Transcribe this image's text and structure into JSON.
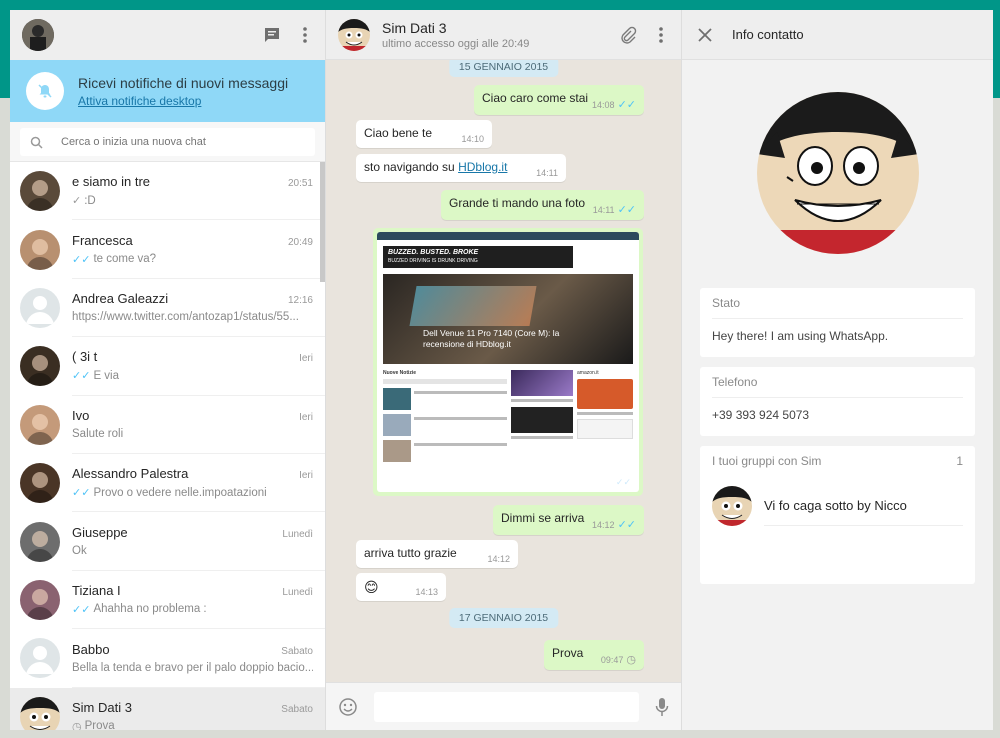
{
  "colors": {
    "teal": "#009688",
    "notif_bg": "#8fd8f7",
    "out_bubble": "#dcf8c6",
    "in_bubble": "#ffffff",
    "read_tick": "#4fc3f7"
  },
  "left": {
    "notification": {
      "title": "Ricevi notifiche di nuovi messaggi",
      "link": "Attiva notifiche desktop"
    },
    "search": {
      "placeholder": "Cerca o inizia una nuova chat"
    },
    "chats": [
      {
        "name": "e siamo in tre",
        "time": "20:51",
        "tick": "grey",
        "msg": ":D",
        "avatar": "#5a4a3a"
      },
      {
        "name": "Francesca",
        "time": "20:49",
        "tick": "blue",
        "msg": "te come va?",
        "avatar": "#b89070"
      },
      {
        "name": "Andrea Galeazzi",
        "time": "12:16",
        "tick": "",
        "msg": "https://www.twitter.com/antozap1/status/55...",
        "avatar": "placeholder"
      },
      {
        "name": "( 3i t",
        "time": "Ieri",
        "tick": "blue",
        "msg": "E via",
        "avatar": "#3a2e22"
      },
      {
        "name": "Ivo",
        "time": "Ieri",
        "tick": "",
        "msg": "Salute roli",
        "avatar": "#c49a7a"
      },
      {
        "name": "Alessandro Palestra",
        "time": "Ieri",
        "tick": "blue",
        "msg": "Provo o vedere nelle.impoatazioni",
        "avatar": "#4a3526"
      },
      {
        "name": "Giuseppe",
        "time": "Lunedì",
        "tick": "",
        "msg": "Ok",
        "avatar": "#6d6d6d"
      },
      {
        "name": "Tiziana I",
        "time": "Lunedì",
        "tick": "blue",
        "msg": "Ahahha no problema :",
        "avatar": "#8a6270"
      },
      {
        "name": "Babbo",
        "time": "Sabato",
        "tick": "",
        "msg": "Bella la tenda e bravo per il palo doppio bacio...",
        "avatar": "placeholder"
      },
      {
        "name": "Sim Dati 3",
        "time": "Sabato",
        "tick": "clock",
        "msg": "Prova",
        "avatar": "luffy"
      }
    ]
  },
  "chat": {
    "name": "Sim Dati 3",
    "status": "ultimo accesso oggi alle 20:49",
    "date1": "15 GENNAIO 2015",
    "date2": "17 GENNAIO 2015",
    "messages": [
      {
        "dir": "out",
        "text": "Ciao caro come stai",
        "time": "14:08"
      },
      {
        "dir": "in",
        "text": "Ciao bene te",
        "time": "14:10"
      },
      {
        "dir": "in",
        "text_pre": "sto navigando su ",
        "link": "HDblog.it",
        "time": "14:11"
      },
      {
        "dir": "out",
        "text": "Grande ti mando una foto",
        "time": "14:11"
      },
      {
        "dir": "out",
        "text": "Dimmi se arriva",
        "time": "14:12"
      },
      {
        "dir": "in",
        "text": "arriva tutto grazie",
        "time": "14:12"
      },
      {
        "dir": "in",
        "text": "😊",
        "time": "14:13"
      },
      {
        "dir": "out",
        "text": "Prova",
        "time": "09:47"
      }
    ],
    "photo": {
      "time": "14:12",
      "banner": "BUZZED. BUSTED. BROKE",
      "banner2": "BUZZED DRIVING IS DRUNK DRIVING",
      "headline": "Dell Venue 11 Pro 7140 (Core M): la recensione di HDblog.it",
      "section": "Nuove Notizie",
      "side": "amazon.it"
    }
  },
  "info": {
    "title": "Info contatto",
    "status_label": "Stato",
    "status_value": "Hey there! I am using WhatsApp.",
    "phone_label": "Telefono",
    "phone_value": "+39 393 924 5073",
    "groups_label": "I tuoi gruppi con Sim",
    "groups_count": "1",
    "group_name": "Vi fo caga sotto by Nicco"
  }
}
